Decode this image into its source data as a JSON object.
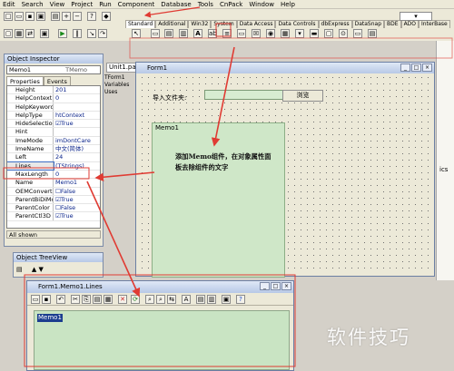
{
  "menu": [
    "Edit",
    "Search",
    "View",
    "Project",
    "Run",
    "Component",
    "Database",
    "Tools",
    "CnPack",
    "Window",
    "Help"
  ],
  "palette_tabs": [
    "Standard",
    "Additional",
    "Win32",
    "System",
    "Data Access",
    "Data Controls",
    "dbExpress",
    "DataSnap",
    "BDE",
    "ADO",
    "InterBase"
  ],
  "object_inspector": {
    "title": "Object Inspector",
    "combo_name": "Memo1",
    "combo_type": "TMemo",
    "tab_properties": "Properties",
    "tab_events": "Events",
    "properties": [
      {
        "k": "Height",
        "v": "201"
      },
      {
        "k": "HelpContext",
        "v": "0"
      },
      {
        "k": "HelpKeyword",
        "v": ""
      },
      {
        "k": "HelpType",
        "v": "htContext"
      },
      {
        "k": "HideSelection",
        "v": "☑True"
      },
      {
        "k": "Hint",
        "v": ""
      },
      {
        "k": "ImeMode",
        "v": "imDontCare"
      },
      {
        "k": "ImeName",
        "v": "中文(简体)"
      },
      {
        "k": "Left",
        "v": "24"
      },
      {
        "k": "Lines",
        "v": "(TStrings)"
      },
      {
        "k": "MaxLength",
        "v": "0"
      },
      {
        "k": "Name",
        "v": "Memo1"
      },
      {
        "k": "OEMConvert",
        "v": "☐False"
      },
      {
        "k": "ParentBiDiMod",
        "v": "☑True"
      },
      {
        "k": "ParentColor",
        "v": "☐False"
      },
      {
        "k": "ParentCtl3D",
        "v": "☑True"
      }
    ],
    "status": "All shown"
  },
  "unit_tab": "Unit1.pas",
  "unit_tree": [
    "TForm1",
    "Variables",
    "Uses"
  ],
  "form": {
    "title": "Form1",
    "import_label": "导入文件夹:",
    "browse_label": "浏览",
    "memo_label": "Memo1",
    "annotation": "添加Memo组件，在对象属性面板去除组件的文字"
  },
  "treeview": {
    "title": "Object TreeView"
  },
  "editor": {
    "title": "Form1.Memo1.Lines",
    "line": "Memo1"
  },
  "watermark": "软件技巧",
  "right_partial": "ics",
  "colors": {
    "markup_red": "#e03b33",
    "memo_green": "#cfe7c8",
    "editor_green": "#c9e4c3"
  }
}
